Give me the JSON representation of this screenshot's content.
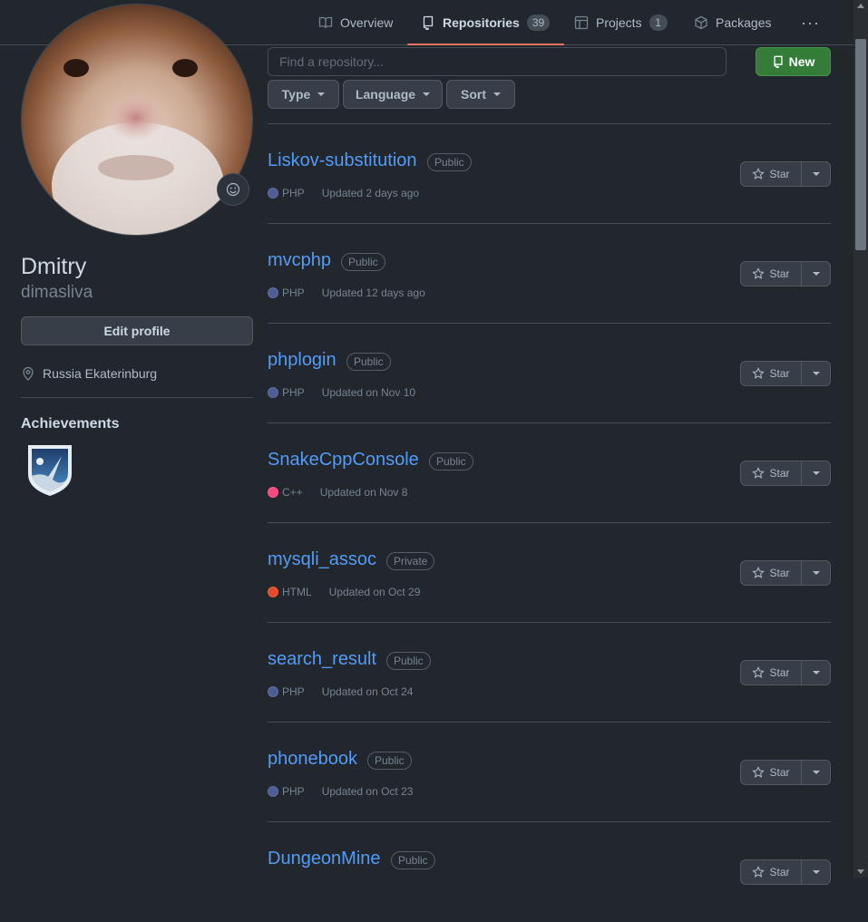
{
  "nav": {
    "tabs": [
      {
        "label": "Overview"
      },
      {
        "label": "Repositories",
        "count": "39"
      },
      {
        "label": "Projects",
        "count": "1"
      },
      {
        "label": "Packages"
      }
    ],
    "more": "···"
  },
  "profile": {
    "name": "Dmitry",
    "login": "dimasliva",
    "edit_label": "Edit profile",
    "location": "Russia Ekaterinburg",
    "achievements_title": "Achievements"
  },
  "filters": {
    "search_placeholder": "Find a repository...",
    "new_label": "New",
    "type_label": "Type",
    "language_label": "Language",
    "sort_label": "Sort"
  },
  "star_label": "Star",
  "colors": {
    "accent": "#ec775c",
    "link": "#539bf5",
    "new_button": "#347d39",
    "php": "#4F5D95",
    "cpp": "#f34b7d",
    "html": "#e34c26"
  },
  "repos": [
    {
      "name": "Liskov-substitution",
      "visibility": "Public",
      "language": "PHP",
      "lang_color": "#4F5D95",
      "updated": "Updated 2 days ago"
    },
    {
      "name": "mvcphp",
      "visibility": "Public",
      "language": "PHP",
      "lang_color": "#4F5D95",
      "updated": "Updated 12 days ago"
    },
    {
      "name": "phplogin",
      "visibility": "Public",
      "language": "PHP",
      "lang_color": "#4F5D95",
      "updated": "Updated on Nov 10"
    },
    {
      "name": "SnakeCppConsole",
      "visibility": "Public",
      "language": "C++",
      "lang_color": "#f34b7d",
      "updated": "Updated on Nov 8"
    },
    {
      "name": "mysqli_assoc",
      "visibility": "Private",
      "language": "HTML",
      "lang_color": "#e34c26",
      "updated": "Updated on Oct 29"
    },
    {
      "name": "search_result",
      "visibility": "Public",
      "language": "PHP",
      "lang_color": "#4F5D95",
      "updated": "Updated on Oct 24"
    },
    {
      "name": "phonebook",
      "visibility": "Public",
      "language": "PHP",
      "lang_color": "#4F5D95",
      "updated": "Updated on Oct 23"
    },
    {
      "name": "DungeonMine",
      "visibility": "Public",
      "language": "",
      "lang_color": "",
      "updated": ""
    }
  ]
}
